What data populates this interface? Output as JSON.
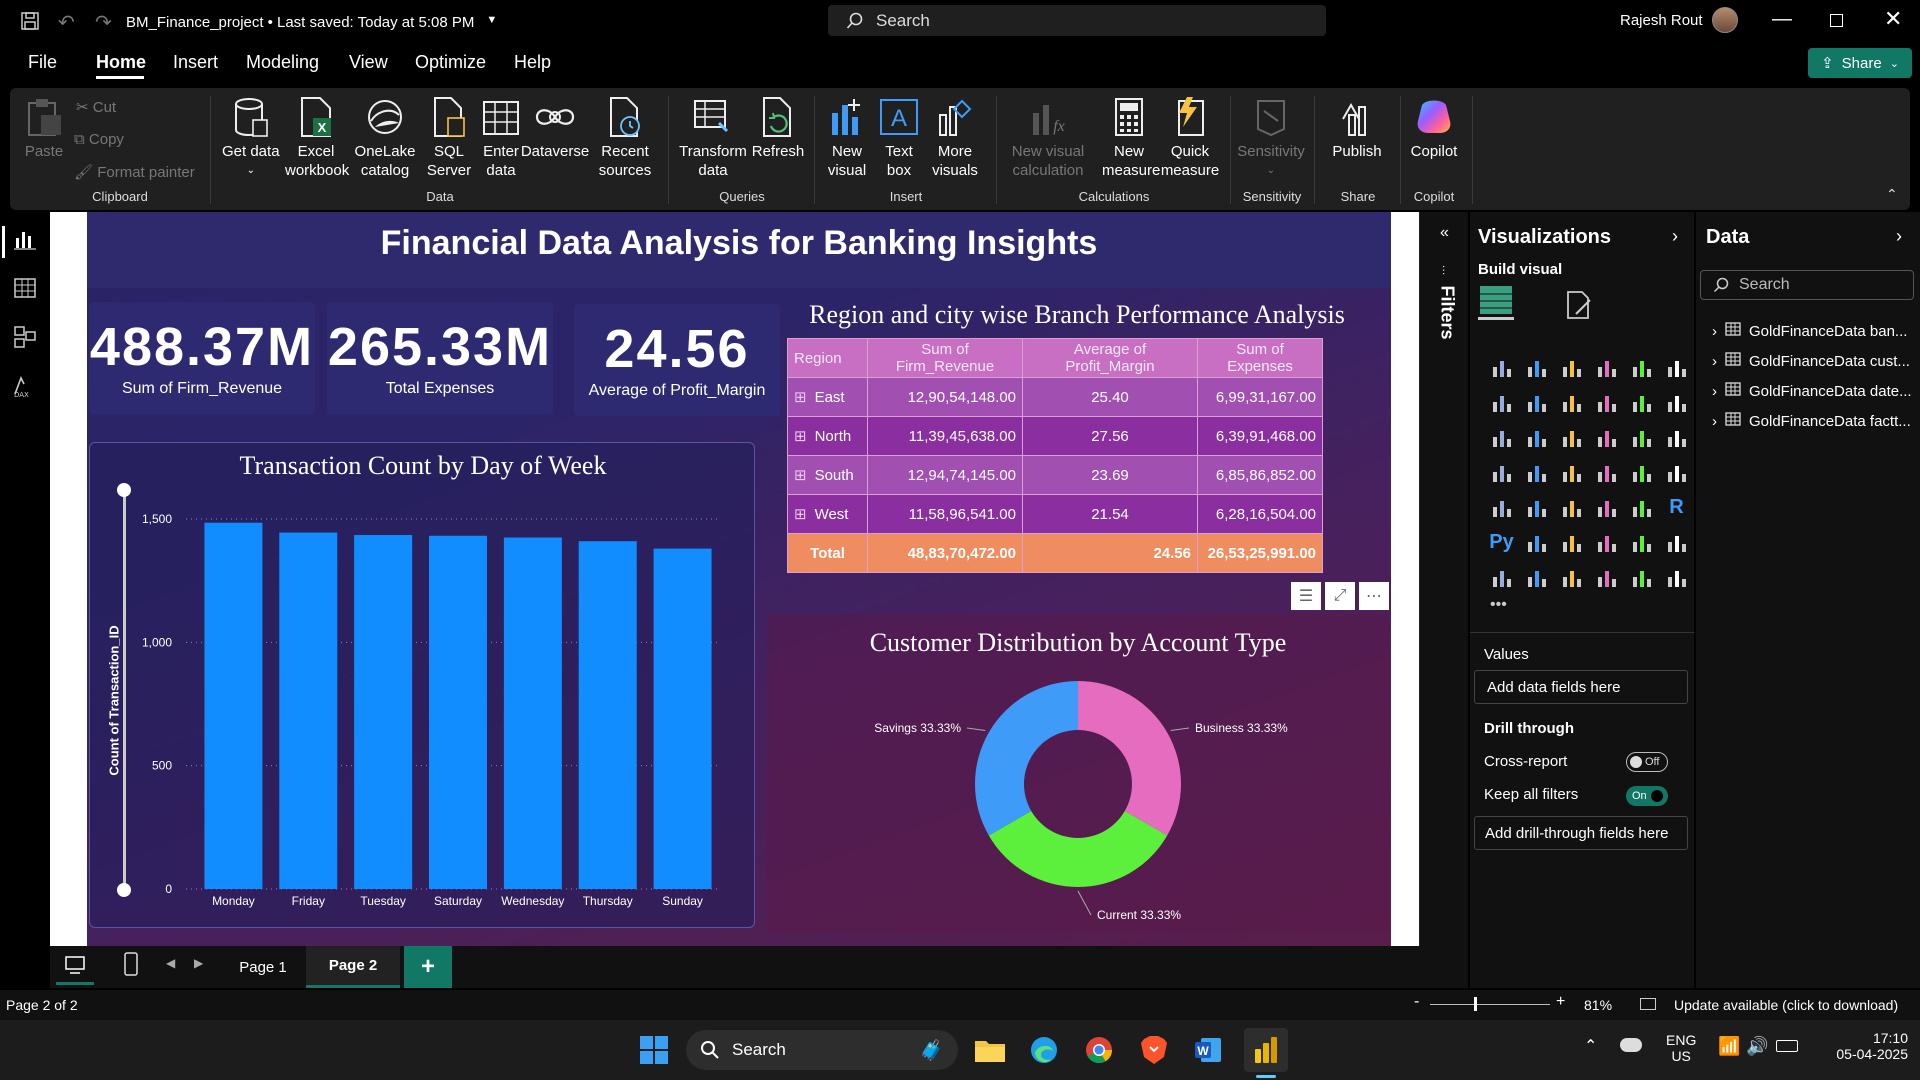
{
  "app": {
    "file_title": "BM_Finance_project",
    "save_status": "• Last saved: Today at 5:08 PM",
    "search_placeholder": "Search",
    "user_name": "Rajesh Rout"
  },
  "menu": [
    "File",
    "Home",
    "Insert",
    "Modeling",
    "View",
    "Optimize",
    "Help"
  ],
  "share_label": "Share",
  "ribbon": {
    "clipboard": {
      "paste": "Paste",
      "cut": "Cut",
      "copy": "Copy",
      "format_painter": "Format painter",
      "group": "Clipboard"
    },
    "data": {
      "get_data": "Get data",
      "excel": "Excel workbook",
      "onelake": "OneLake catalog",
      "sql": "SQL Server",
      "enter": "Enter data",
      "dataverse": "Dataverse",
      "recent": "Recent sources",
      "group": "Data"
    },
    "queries": {
      "transform": "Transform data",
      "refresh": "Refresh",
      "group": "Queries"
    },
    "insert": {
      "new_visual": "New visual",
      "text_box": "Text box",
      "more_visuals": "More visuals",
      "group": "Insert"
    },
    "calculations": {
      "new_visual_calc": "New visual calculation",
      "new_measure": "New measure",
      "quick_measure": "Quick measure",
      "group": "Calculations"
    },
    "sensitivity": {
      "label": "Sensitivity",
      "group": "Sensitivity"
    },
    "share": {
      "publish": "Publish",
      "group": "Share"
    },
    "copilot": {
      "label": "Copilot",
      "group": "Copilot"
    }
  },
  "report": {
    "title": "Financial Data Analysis for Banking Insights",
    "kpis": [
      {
        "value": "488.37M",
        "label": "Sum of Firm_Revenue"
      },
      {
        "value": "265.33M",
        "label": "Total  Expenses"
      },
      {
        "value": "24.56",
        "label": "Average of Profit_Margin"
      }
    ],
    "matrix": {
      "title": "Region and city wise Branch Performance Analysis",
      "headers": [
        "Region",
        "Sum of Firm_Revenue",
        "Average of Profit_Margin",
        "Sum of Expenses"
      ],
      "rows": [
        [
          "East",
          "12,90,54,148.00",
          "25.40",
          "6,99,31,167.00"
        ],
        [
          "North",
          "11,39,45,638.00",
          "27.56",
          "6,39,91,468.00"
        ],
        [
          "South",
          "12,94,74,145.00",
          "23.69",
          "6,85,86,852.00"
        ],
        [
          "West",
          "11,58,96,541.00",
          "21.54",
          "6,28,16,504.00"
        ]
      ],
      "total": [
        "Total",
        "48,83,70,472.00",
        "24.56",
        "26,53,25,991.00"
      ]
    },
    "bar_chart": {
      "title": "Transaction Count by Day of Week",
      "ylabel": "Count of Transaction_ID"
    },
    "donut_chart": {
      "title": "Customer Distribution by Account Type"
    }
  },
  "chart_data": [
    {
      "type": "bar",
      "title": "Transaction Count by Day of Week",
      "xlabel": "",
      "ylabel": "Count of Transaction_ID",
      "categories": [
        "Monday",
        "Friday",
        "Tuesday",
        "Saturday",
        "Wednesday",
        "Thursday",
        "Sunday"
      ],
      "values": [
        1485,
        1445,
        1435,
        1432,
        1425,
        1410,
        1380
      ],
      "ylim": [
        0,
        1500
      ],
      "yticks": [
        "0",
        "500",
        "1,000",
        "1,500"
      ],
      "grid": true,
      "color": "#118DFF"
    },
    {
      "type": "pie",
      "title": "Customer Distribution by Account Type",
      "categories": [
        "Business",
        "Current",
        "Savings"
      ],
      "values": [
        33.33,
        33.33,
        33.33
      ],
      "labels": [
        "Business 33.33%",
        "Current 33.33%",
        "Savings 33.33%"
      ],
      "colors": [
        "#E66CC0",
        "#5CF03C",
        "#3E9BF7"
      ]
    }
  ],
  "filters_label": "Filters",
  "viz_pane": {
    "title": "Visualizations",
    "build_visual": "Build visual",
    "values_label": "Values",
    "add_data_fields": "Add data fields here",
    "drill_through": "Drill through",
    "cross_report": "Cross-report",
    "cross_report_state": "Off",
    "keep_all_filters": "Keep all filters",
    "keep_all_filters_state": "On",
    "add_drill_fields": "Add drill-through fields here",
    "py_label": "Py",
    "r_label": "R"
  },
  "data_pane": {
    "title": "Data",
    "search_placeholder": "Search",
    "tables": [
      "GoldFinanceData ban...",
      "GoldFinanceData cust...",
      "GoldFinanceData date...",
      "GoldFinanceData factt..."
    ]
  },
  "pages": [
    "Page 1",
    "Page 2"
  ],
  "add_page": "+",
  "status": {
    "page_info": "Page 2 of 2",
    "zoom": "81%",
    "update": "Update available (click to download)"
  },
  "taskbar": {
    "search": "Search",
    "lang1": "ENG",
    "lang2": "US",
    "time": "17:10",
    "date": "05-04-2025"
  }
}
